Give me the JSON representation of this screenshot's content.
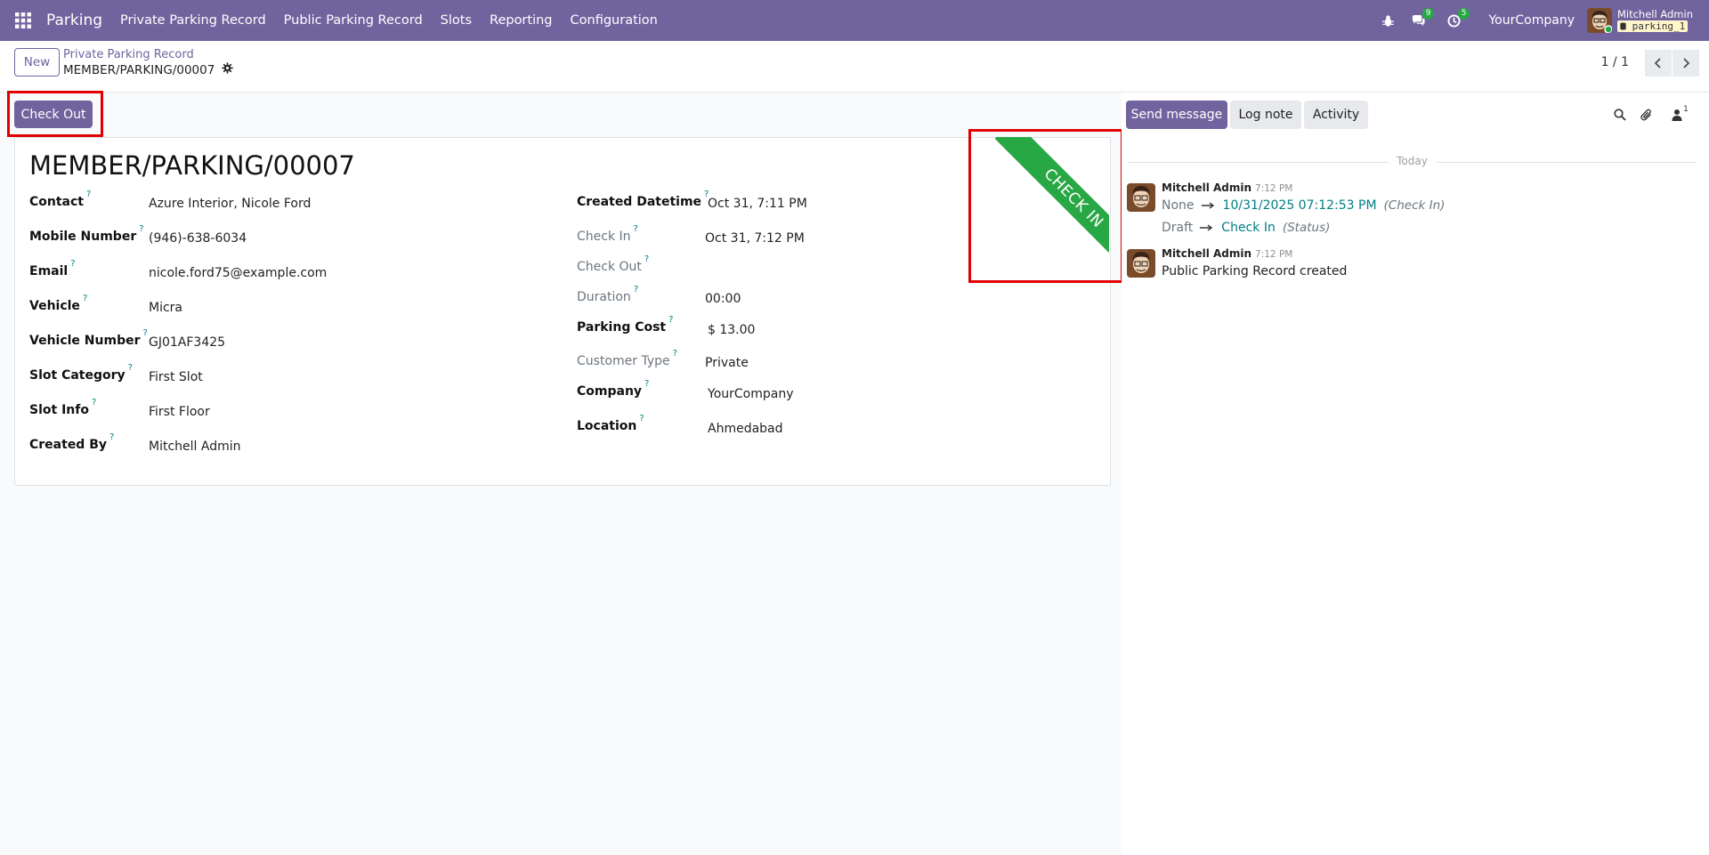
{
  "navbar": {
    "brand": "Parking",
    "menu": [
      "Private Parking Record",
      "Public Parking Record",
      "Slots",
      "Reporting",
      "Configuration"
    ],
    "messages_count": "9",
    "activities_count": "5",
    "company": "YourCompany",
    "user_name": "Mitchell Admin",
    "database": "parking_1"
  },
  "control": {
    "new_label": "New",
    "breadcrumb": "Private Parking Record",
    "record_name": "MEMBER/PARKING/00007",
    "pager": "1 / 1"
  },
  "status_bar": {
    "checkout_label": "Check Out"
  },
  "form": {
    "title": "MEMBER/PARKING/00007",
    "ribbon": "CHECK IN",
    "left_fields": [
      {
        "label": "Contact",
        "value": "Azure Interior, Nicole Ford"
      },
      {
        "label": "Mobile Number",
        "value": "(946)-638-6034"
      },
      {
        "label": "Email",
        "value": "nicole.ford75@example.com"
      },
      {
        "label": "Vehicle",
        "value": "Micra"
      },
      {
        "label": "Vehicle Number",
        "value": "GJ01AF3425"
      },
      {
        "label": "Slot Category",
        "value": "First Slot"
      },
      {
        "label": "Slot Info",
        "value": "First Floor"
      },
      {
        "label": "Created By",
        "value": "Mitchell Admin"
      }
    ],
    "right_fields": [
      {
        "label": "Created Datetime",
        "value": "Oct 31, 7:11 PM"
      },
      {
        "label": "Check In",
        "value": "Oct 31, 7:12 PM"
      },
      {
        "label": "Check Out",
        "value": ""
      },
      {
        "label": "Duration",
        "value": "00:00"
      },
      {
        "label": "Parking Cost",
        "value": "$ 13.00"
      },
      {
        "label": "Customer Type",
        "value": "Private"
      },
      {
        "label": "Company",
        "value": "YourCompany"
      },
      {
        "label": "Location",
        "value": "Ahmedabad"
      }
    ],
    "help_mark": "?"
  },
  "chatter": {
    "send_message": "Send message",
    "log_note": "Log note",
    "activity": "Activity",
    "followers_count": "1",
    "today": "Today",
    "messages": [
      {
        "author": "Mitchell Admin",
        "time": "7:12 PM",
        "tracking": [
          {
            "old": "None",
            "new": "10/31/2025 07:12:53 PM",
            "field": "(Check In)"
          },
          {
            "old": "Draft",
            "new": "Check In",
            "field": "(Status)"
          }
        ]
      },
      {
        "author": "Mitchell Admin",
        "time": "7:12 PM",
        "body": "Public Parking Record created"
      }
    ]
  },
  "colors": {
    "brand": "#71639e",
    "ribbon": "#28a745",
    "highlight": "#e10000",
    "link": "#017e84"
  }
}
